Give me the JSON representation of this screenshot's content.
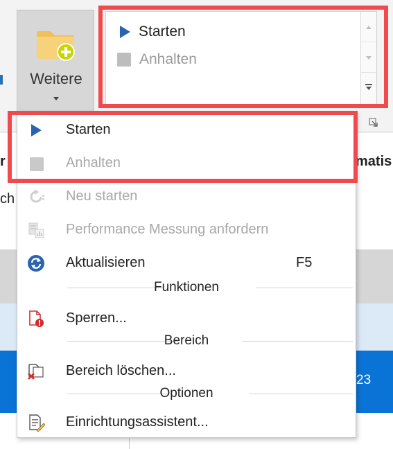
{
  "ribbon": {
    "more_button_label": "Weitere",
    "gallery_items": [
      {
        "label": "Starten",
        "icon": "play-icon",
        "enabled": true
      },
      {
        "label": "Anhalten",
        "icon": "stop-icon",
        "enabled": false
      }
    ]
  },
  "background": {
    "column_left_fragment": "r",
    "column_right_fragment": "matis",
    "subrow_fragment": "ch",
    "selected_row_value": "23"
  },
  "menu": {
    "items": [
      {
        "label": "Starten",
        "icon": "play-icon",
        "enabled": true
      },
      {
        "label": "Anhalten",
        "icon": "stop-icon",
        "enabled": false
      },
      {
        "label": "Neu starten",
        "icon": "restart-icon",
        "enabled": false
      },
      {
        "label": "Performance Messung anfordern",
        "icon": "performance-icon",
        "enabled": false
      },
      {
        "label": "Aktualisieren",
        "icon": "refresh-icon",
        "enabled": true,
        "shortcut": "F5"
      }
    ],
    "sections": [
      {
        "title": "Funktionen",
        "items": [
          {
            "label": "Sperren...",
            "icon": "lock-document-icon",
            "enabled": true
          }
        ]
      },
      {
        "title": "Bereich",
        "items": [
          {
            "label": "Bereich löschen...",
            "icon": "delete-area-icon",
            "enabled": true
          }
        ]
      },
      {
        "title": "Optionen",
        "items": [
          {
            "label": "Einrichtungsassistent...",
            "icon": "setup-wizard-icon",
            "enabled": true
          }
        ]
      }
    ]
  },
  "colors": {
    "highlight": "#f04a4f",
    "accent_blue": "#2a63b1",
    "selection_blue": "#0a73d6"
  }
}
